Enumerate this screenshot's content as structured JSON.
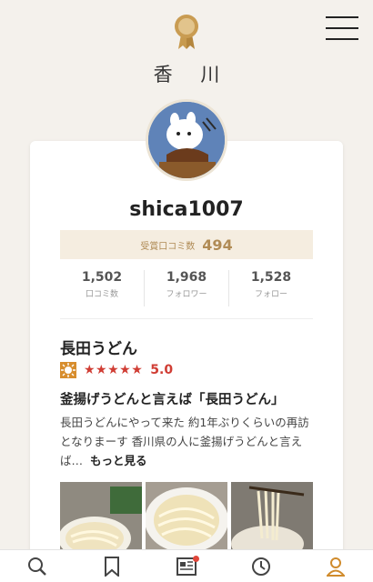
{
  "header": {
    "region": "香 川",
    "icons": {
      "medal": "medal-icon",
      "menu": "hamburger-menu-icon"
    }
  },
  "profile": {
    "username": "shica1007",
    "award": {
      "label": "受賞口コミ数",
      "value": "494"
    },
    "stats": [
      {
        "value": "1,502",
        "label": "口コミ数"
      },
      {
        "value": "1,968",
        "label": "フォロワー"
      },
      {
        "value": "1,528",
        "label": "フォロー"
      }
    ]
  },
  "review": {
    "shop_name": "長田うどん",
    "stars": "★★★★★",
    "rating": "5.0",
    "title": "釜揚げうどんと言えば「長田うどん」",
    "body": "長田うどんにやって来た 約1年ぶりくらいの再訪となりまーす 香川県の人に釜揚げうどんと言えば…",
    "more_label": "もっと見る"
  },
  "colors": {
    "accent": "#b08b55",
    "star": "#d03d34",
    "award_bg": "#f5ede0"
  },
  "bottom_nav": [
    "search-icon",
    "bookmark-icon",
    "news-icon",
    "history-icon",
    "profile-icon"
  ]
}
